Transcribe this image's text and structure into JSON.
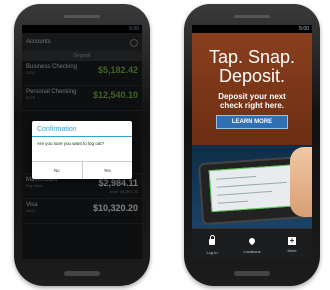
{
  "left_phone": {
    "status_time": "5:00",
    "title": "Accounts",
    "section_header": "Deposit",
    "accounts": [
      {
        "name": "Business Checking",
        "sub": "1234",
        "balance": "$5,182.42",
        "balance2": ""
      },
      {
        "name": "Personal Checking",
        "sub": "5678",
        "balance": "$12,540.10",
        "balance2": ""
      }
    ],
    "accounts_below": [
      {
        "name": "MasterCard",
        "sub": "Pay Now",
        "balance": "$2,984.11",
        "balance2": "Avail: $5,967.20"
      },
      {
        "name": "Visa",
        "sub": "0423",
        "balance": "$10,320.20",
        "balance2": ""
      }
    ],
    "dialog": {
      "title": "Confirmation",
      "message": "Are you sure you want to log out?",
      "no_label": "No",
      "yes_label": "Yes"
    }
  },
  "right_phone": {
    "status_time": "5:00",
    "headline_line1": "Tap. Snap.",
    "headline_line2": "Deposit.",
    "subline_line1": "Deposit your next",
    "subline_line2": "check right here.",
    "learn_more": "LEARN MORE",
    "nav": [
      {
        "label": "Log In",
        "icon": "lock-icon"
      },
      {
        "label": "Locations",
        "icon": "location-pin-icon"
      },
      {
        "label": "More",
        "icon": "plus-icon"
      }
    ]
  },
  "colors": {
    "balance_green": "#6fb44a",
    "dialog_accent": "#3a9fd6",
    "promo_bg": "#7a3618",
    "button_blue": "#2f6fb3"
  }
}
